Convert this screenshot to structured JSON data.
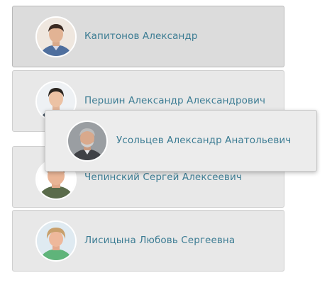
{
  "people": [
    {
      "name": "Капитонов Александр"
    },
    {
      "name": "Першин Александр Александрович"
    },
    {
      "name": "Чепинский Сергей Алексеевич"
    },
    {
      "name": "Лисицына Любовь Сергеевна"
    }
  ],
  "dragged_person": {
    "name": "Усольцев Александр Анатольевич"
  },
  "colors": {
    "name_text": "#3c7c93",
    "card_bg": "#e8e8e8",
    "card_selected_bg": "#dcdcdc"
  },
  "icons": [
    "person-avatar-image"
  ]
}
